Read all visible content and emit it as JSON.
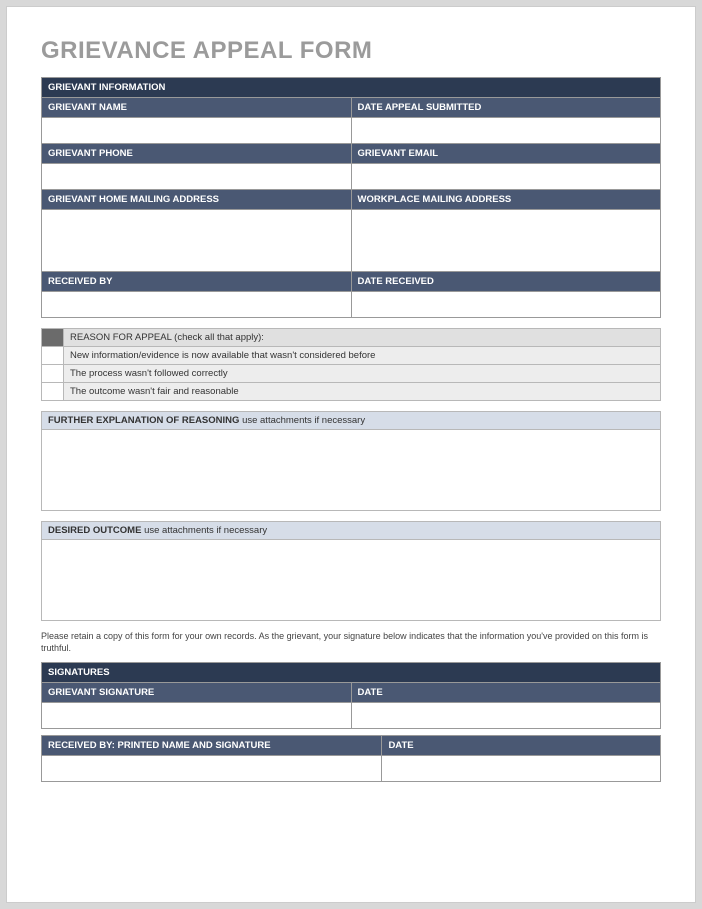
{
  "title": "GRIEVANCE APPEAL FORM",
  "section1": {
    "header": "GRIEVANT INFORMATION",
    "fields": {
      "name": "GRIEVANT NAME",
      "dateSubmitted": "DATE APPEAL SUBMITTED",
      "phone": "GRIEVANT PHONE",
      "email": "GRIEVANT EMAIL",
      "homeAddress": "GRIEVANT HOME MAILING ADDRESS",
      "workAddress": "WORKPLACE MAILING ADDRESS",
      "receivedBy": "RECEIVED BY",
      "dateReceived": "DATE RECEIVED"
    }
  },
  "reasons": {
    "header": "REASON FOR APPEAL (check all that apply):",
    "items": [
      "New information/evidence is now available that wasn't considered before",
      "The process wasn't followed correctly",
      "The outcome wasn't fair and reasonable"
    ]
  },
  "explanation": {
    "title": "FURTHER EXPLANATION OF REASONING",
    "hint": "use attachments if necessary"
  },
  "outcome": {
    "title": "DESIRED OUTCOME",
    "hint": "use attachments if necessary"
  },
  "note": "Please retain a copy of this form for your own records.  As the grievant, your signature below indicates that the information you've provided on this form is truthful.",
  "signatures": {
    "header": "SIGNATURES",
    "grievantSig": "GRIEVANT SIGNATURE",
    "date1": "DATE",
    "receivedBy": "RECEIVED BY: PRINTED NAME AND SIGNATURE",
    "date2": "DATE"
  }
}
